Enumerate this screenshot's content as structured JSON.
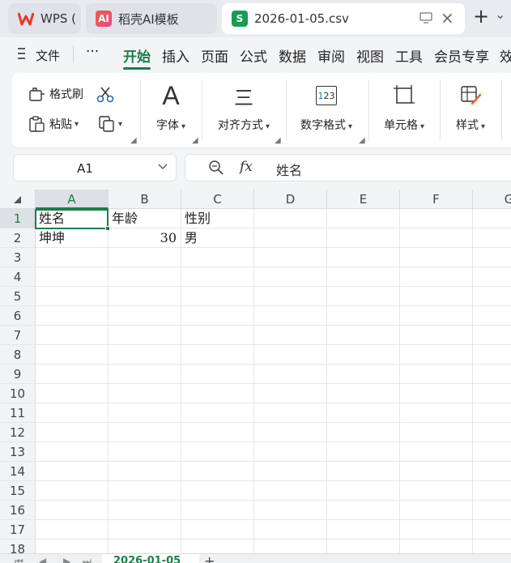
{
  "tabs": [
    {
      "label": "WPS (",
      "icon": "wps-logo-icon",
      "color": "#e8372c"
    },
    {
      "label": "稻壳AI模板",
      "icon": "docer-ai-icon",
      "color": "#e84a8a"
    },
    {
      "label": "2026-01-05.csv",
      "icon": "spreadsheet-s-icon",
      "color": "#1a9b56",
      "active": true
    }
  ],
  "tab_controls": {
    "monitor": "monitor-icon",
    "close": "×",
    "new": "+",
    "more": "⌄"
  },
  "menu": {
    "file": "文件",
    "more": "···",
    "items": [
      "开始",
      "插入",
      "页面",
      "公式",
      "数据",
      "审阅",
      "视图",
      "工具",
      "会员专享",
      "效"
    ],
    "active": "开始"
  },
  "ribbon": {
    "format_painter": "格式刷",
    "paste": "粘贴",
    "font": "字体",
    "align": "对齐方式",
    "number_format": "数字格式",
    "cell": "单元格",
    "style": "样式",
    "font_glyph": "A",
    "align_glyph": "三",
    "numfmt_glyph": "1",
    "numfmt_glyph2": "2",
    "numfmt_glyph3": "3"
  },
  "formula_bar": {
    "cell_ref": "A1",
    "fx": "fx",
    "content": "姓名"
  },
  "grid": {
    "columns": [
      "A",
      "B",
      "C",
      "D",
      "E",
      "F",
      "G"
    ],
    "selected_column": "A",
    "rows": [
      "1",
      "2",
      "3",
      "4",
      "5",
      "6",
      "7",
      "8",
      "9",
      "10",
      "11",
      "12",
      "13",
      "14",
      "15",
      "16",
      "17",
      "18"
    ],
    "selected_row": "1",
    "cells": {
      "A1": "姓名",
      "B1": "年龄",
      "C1": "性别",
      "A2": "坤坤",
      "B2": "30",
      "C2": "男"
    }
  },
  "sheet": {
    "tab": "2026-01-05",
    "add": "+"
  },
  "colors": {
    "accent": "#1a7f4b",
    "wps_red": "#e8372c",
    "sheet_green": "#1a9b56"
  }
}
